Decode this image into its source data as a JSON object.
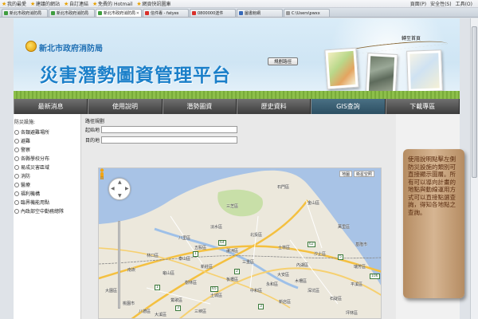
{
  "browser": {
    "bookmarks": [
      {
        "label": "我的最愛",
        "icon": "star-icon"
      },
      {
        "label": "建議的網站",
        "icon": "star-icon"
      },
      {
        "label": "自訂連結",
        "icon": "star-icon"
      },
      {
        "label": "免費的 Hotmail",
        "icon": "star-icon"
      },
      {
        "label": "網頁快訊圖庫",
        "icon": "star-icon"
      }
    ],
    "tabs": [
      {
        "title": "新北市政府消防局",
        "favicon": "green"
      },
      {
        "title": "新北市政府消防局",
        "favicon": "green"
      },
      {
        "title": "新北市政府消防局",
        "favicon": "green"
      },
      {
        "title": "信件專 - fatyes",
        "favicon": "red"
      },
      {
        "title": "0800000送件",
        "favicon": "red"
      },
      {
        "title": "圖書館網",
        "favicon": "blue"
      },
      {
        "title": "C:\\Users\\pwxx",
        "favicon": "white"
      }
    ],
    "menu": {
      "page": "頁面(P)",
      "safety": "安全性(S)",
      "tools": "工具(O)"
    }
  },
  "header": {
    "agency": "新北市政府消防局",
    "title": "災害潛勢圖資管理平台",
    "link": "轉至首頁"
  },
  "nav": [
    {
      "label": "最新消息",
      "active": false
    },
    {
      "label": "使用說明",
      "active": false
    },
    {
      "label": "潛勢圖資",
      "active": false
    },
    {
      "label": "歷史資料",
      "active": false
    },
    {
      "label": "GIS查詢",
      "active": true
    },
    {
      "label": "下載專區",
      "active": false
    }
  ],
  "sidebar": {
    "heading": "防災設施:",
    "items": [
      "各類避難場所",
      "避難",
      "警察",
      "各縣學校分布",
      "易成災害區域",
      "消防",
      "醫療",
      "福利機構",
      "臨界機能用點",
      "內政部空中勤務總隊"
    ]
  },
  "route": {
    "title": "路徑規劃",
    "start_label": "起始地",
    "end_label": "目的地",
    "start_value": "",
    "end_value": "",
    "button": "規劃路徑"
  },
  "map": {
    "type_map": "地圖",
    "type_satellite": "衛星空照",
    "places": [
      "石門區",
      "金山區",
      "萬里區",
      "三芝區",
      "淡水區",
      "北投區",
      "士林區",
      "基隆市",
      "汐止區",
      "八里區",
      "內湖區",
      "林口區",
      "蘆洲區",
      "三重區",
      "大安區",
      "新莊區",
      "板橋區",
      "中和區",
      "永和區",
      "樹林區",
      "土城區",
      "三峽區",
      "新店區",
      "深坑區",
      "石碇區",
      "坪林區",
      "鶯歌區",
      "大溪區",
      "大園區",
      "桃園市",
      "八德區",
      "南崁",
      "龜山區",
      "五股區",
      "泰山區",
      "瑞芳區",
      "平溪區",
      "木柵區"
    ],
    "route_shields": [
      "1",
      "2",
      "3",
      "5",
      "62",
      "64",
      "106",
      "65",
      "1",
      "3"
    ]
  },
  "notice": {
    "text": "使用說明點擊左側防災設施的類別可直接顯示圖層。所有可以導向計畫的地點與動線運用方式可以直接點選查詢，得知各地點之查詢。"
  }
}
